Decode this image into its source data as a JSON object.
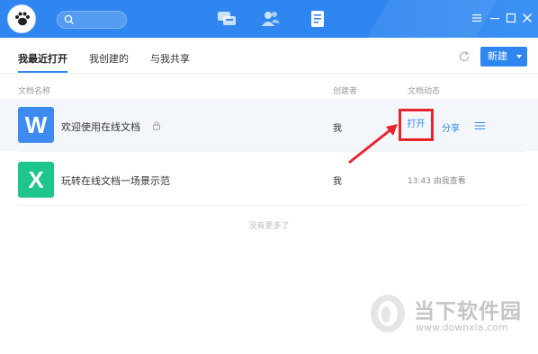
{
  "titlebar": {
    "search": {
      "placeholder": ""
    },
    "nav_icons": [
      "chat-icon",
      "contacts-icon",
      "documents-icon"
    ],
    "window_controls": [
      "menu-icon",
      "minimize-icon",
      "maximize-icon",
      "close-icon"
    ]
  },
  "toolbar": {
    "tabs": [
      {
        "label": "我最近打开",
        "active": true
      },
      {
        "label": "我创建的",
        "active": false
      },
      {
        "label": "与我共享",
        "active": false
      }
    ],
    "new_label": "新建"
  },
  "columns": {
    "name": "文档名称",
    "creator": "创建者",
    "activity": "文档动态"
  },
  "files": [
    {
      "icon_letter": "W",
      "name": "欢迎使用在线文档",
      "creator": "我",
      "open_label": "打开",
      "share_label": "分享"
    },
    {
      "icon_letter": "X",
      "name": "玩转在线文档一场景示范",
      "creator": "我",
      "status": "13:43 由我查看"
    }
  ],
  "footer": {
    "no_more": "没有更多了"
  },
  "watermark": {
    "title": "当下软件园",
    "url": "www.downxia.com"
  },
  "colors": {
    "accent": "#2f86f0",
    "word": "#3d8bf0",
    "excel": "#1ec58c",
    "highlight": "#e8252a"
  }
}
